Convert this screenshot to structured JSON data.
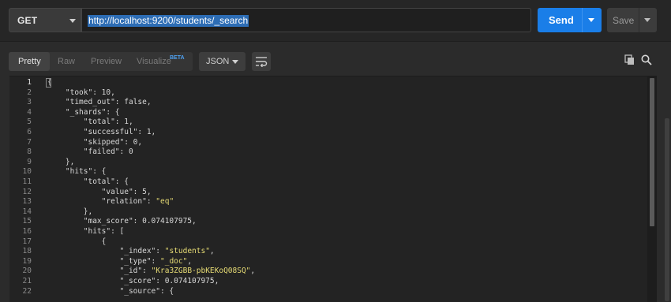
{
  "request": {
    "method": "GET",
    "url": "http://localhost:9200/students/_search",
    "send_label": "Send",
    "save_label": "Save"
  },
  "response_toolbar": {
    "view_tabs": [
      "Pretty",
      "Raw",
      "Preview",
      "Visualize"
    ],
    "beta_label": "BETA",
    "active_tab": "Pretty",
    "format": "JSON"
  },
  "editor": {
    "lines": [
      {
        "n": "1",
        "t": "{"
      },
      {
        "n": "2",
        "t": "    \"took\": 10,"
      },
      {
        "n": "3",
        "t": "    \"timed_out\": false,"
      },
      {
        "n": "4",
        "t": "    \"_shards\": {"
      },
      {
        "n": "5",
        "t": "        \"total\": 1,"
      },
      {
        "n": "6",
        "t": "        \"successful\": 1,"
      },
      {
        "n": "7",
        "t": "        \"skipped\": 0,"
      },
      {
        "n": "8",
        "t": "        \"failed\": 0"
      },
      {
        "n": "9",
        "t": "    },"
      },
      {
        "n": "10",
        "t": "    \"hits\": {"
      },
      {
        "n": "11",
        "t": "        \"total\": {"
      },
      {
        "n": "12",
        "t": "            \"value\": 5,"
      },
      {
        "n": "13",
        "t": "            \"relation\": \"eq\""
      },
      {
        "n": "14",
        "t": "        },"
      },
      {
        "n": "15",
        "t": "        \"max_score\": 0.074107975,"
      },
      {
        "n": "16",
        "t": "        \"hits\": ["
      },
      {
        "n": "17",
        "t": "            {"
      },
      {
        "n": "18",
        "t": "                \"_index\": \"students\","
      },
      {
        "n": "19",
        "t": "                \"_type\": \"_doc\","
      },
      {
        "n": "20",
        "t": "                \"_id\": \"Kra3ZGBB-pbKEKoQ08SQ\","
      },
      {
        "n": "21",
        "t": "                \"_score\": 0.074107975,"
      },
      {
        "n": "22",
        "t": "                \"_source\": {"
      }
    ]
  },
  "colors": {
    "send": "#1a7ee8",
    "string": "#e6db74",
    "selection": "#2d6db5",
    "beta": "#4da0f0"
  },
  "icons": [
    "chevron-down-icon",
    "wrap-lines-icon",
    "copy-icon",
    "search-icon"
  ]
}
